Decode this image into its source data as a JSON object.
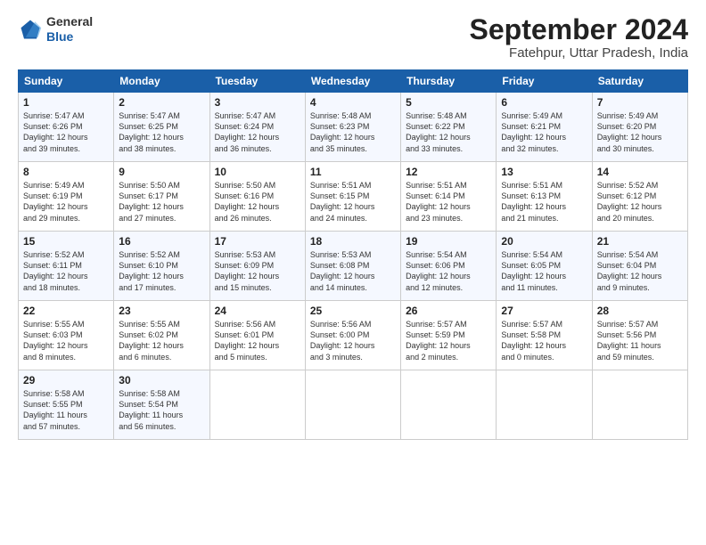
{
  "logo": {
    "general": "General",
    "blue": "Blue"
  },
  "title": "September 2024",
  "location": "Fatehpur, Uttar Pradesh, India",
  "headers": [
    "Sunday",
    "Monday",
    "Tuesday",
    "Wednesday",
    "Thursday",
    "Friday",
    "Saturday"
  ],
  "weeks": [
    [
      {
        "day": "1",
        "sunrise": "5:47 AM",
        "sunset": "6:26 PM",
        "daylight": "12 hours and 39 minutes."
      },
      {
        "day": "2",
        "sunrise": "5:47 AM",
        "sunset": "6:25 PM",
        "daylight": "12 hours and 38 minutes."
      },
      {
        "day": "3",
        "sunrise": "5:47 AM",
        "sunset": "6:24 PM",
        "daylight": "12 hours and 36 minutes."
      },
      {
        "day": "4",
        "sunrise": "5:48 AM",
        "sunset": "6:23 PM",
        "daylight": "12 hours and 35 minutes."
      },
      {
        "day": "5",
        "sunrise": "5:48 AM",
        "sunset": "6:22 PM",
        "daylight": "12 hours and 33 minutes."
      },
      {
        "day": "6",
        "sunrise": "5:49 AM",
        "sunset": "6:21 PM",
        "daylight": "12 hours and 32 minutes."
      },
      {
        "day": "7",
        "sunrise": "5:49 AM",
        "sunset": "6:20 PM",
        "daylight": "12 hours and 30 minutes."
      }
    ],
    [
      {
        "day": "8",
        "sunrise": "5:49 AM",
        "sunset": "6:19 PM",
        "daylight": "12 hours and 29 minutes."
      },
      {
        "day": "9",
        "sunrise": "5:50 AM",
        "sunset": "6:17 PM",
        "daylight": "12 hours and 27 minutes."
      },
      {
        "day": "10",
        "sunrise": "5:50 AM",
        "sunset": "6:16 PM",
        "daylight": "12 hours and 26 minutes."
      },
      {
        "day": "11",
        "sunrise": "5:51 AM",
        "sunset": "6:15 PM",
        "daylight": "12 hours and 24 minutes."
      },
      {
        "day": "12",
        "sunrise": "5:51 AM",
        "sunset": "6:14 PM",
        "daylight": "12 hours and 23 minutes."
      },
      {
        "day": "13",
        "sunrise": "5:51 AM",
        "sunset": "6:13 PM",
        "daylight": "12 hours and 21 minutes."
      },
      {
        "day": "14",
        "sunrise": "5:52 AM",
        "sunset": "6:12 PM",
        "daylight": "12 hours and 20 minutes."
      }
    ],
    [
      {
        "day": "15",
        "sunrise": "5:52 AM",
        "sunset": "6:11 PM",
        "daylight": "12 hours and 18 minutes."
      },
      {
        "day": "16",
        "sunrise": "5:52 AM",
        "sunset": "6:10 PM",
        "daylight": "12 hours and 17 minutes."
      },
      {
        "day": "17",
        "sunrise": "5:53 AM",
        "sunset": "6:09 PM",
        "daylight": "12 hours and 15 minutes."
      },
      {
        "day": "18",
        "sunrise": "5:53 AM",
        "sunset": "6:08 PM",
        "daylight": "12 hours and 14 minutes."
      },
      {
        "day": "19",
        "sunrise": "5:54 AM",
        "sunset": "6:06 PM",
        "daylight": "12 hours and 12 minutes."
      },
      {
        "day": "20",
        "sunrise": "5:54 AM",
        "sunset": "6:05 PM",
        "daylight": "12 hours and 11 minutes."
      },
      {
        "day": "21",
        "sunrise": "5:54 AM",
        "sunset": "6:04 PM",
        "daylight": "12 hours and 9 minutes."
      }
    ],
    [
      {
        "day": "22",
        "sunrise": "5:55 AM",
        "sunset": "6:03 PM",
        "daylight": "12 hours and 8 minutes."
      },
      {
        "day": "23",
        "sunrise": "5:55 AM",
        "sunset": "6:02 PM",
        "daylight": "12 hours and 6 minutes."
      },
      {
        "day": "24",
        "sunrise": "5:56 AM",
        "sunset": "6:01 PM",
        "daylight": "12 hours and 5 minutes."
      },
      {
        "day": "25",
        "sunrise": "5:56 AM",
        "sunset": "6:00 PM",
        "daylight": "12 hours and 3 minutes."
      },
      {
        "day": "26",
        "sunrise": "5:57 AM",
        "sunset": "5:59 PM",
        "daylight": "12 hours and 2 minutes."
      },
      {
        "day": "27",
        "sunrise": "5:57 AM",
        "sunset": "5:58 PM",
        "daylight": "12 hours and 0 minutes."
      },
      {
        "day": "28",
        "sunrise": "5:57 AM",
        "sunset": "5:56 PM",
        "daylight": "11 hours and 59 minutes."
      }
    ],
    [
      {
        "day": "29",
        "sunrise": "5:58 AM",
        "sunset": "5:55 PM",
        "daylight": "11 hours and 57 minutes."
      },
      {
        "day": "30",
        "sunrise": "5:58 AM",
        "sunset": "5:54 PM",
        "daylight": "11 hours and 56 minutes."
      },
      null,
      null,
      null,
      null,
      null
    ]
  ]
}
